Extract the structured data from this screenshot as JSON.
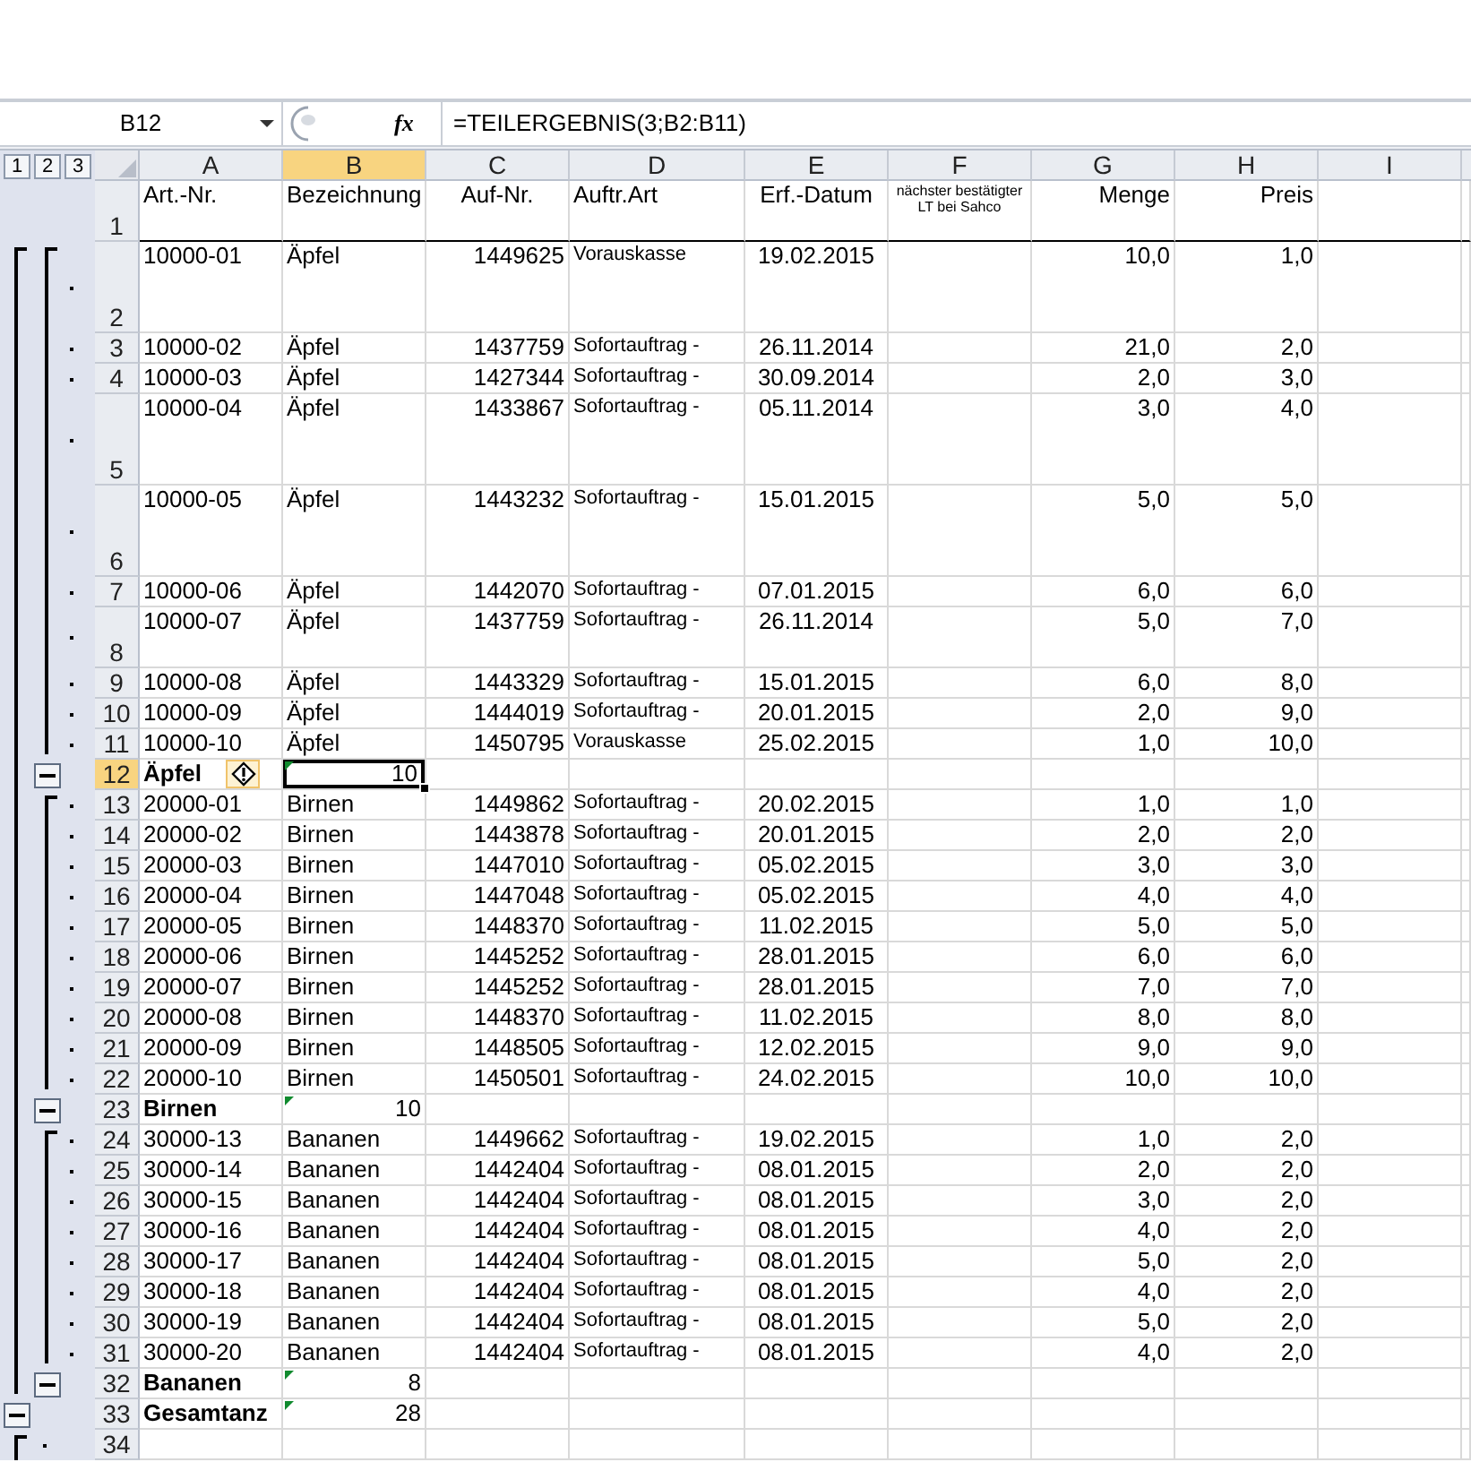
{
  "formula_bar": {
    "name_box": "B12",
    "function_label": "fx",
    "formula": "=TEILERGEBNIS(3;B2:B11)"
  },
  "outline_levels": [
    {
      "label": "1"
    },
    {
      "label": "2"
    },
    {
      "label": "3"
    }
  ],
  "columns": [
    {
      "label": "A",
      "selected": false
    },
    {
      "label": "B",
      "selected": true
    },
    {
      "label": "C",
      "selected": false
    },
    {
      "label": "D",
      "selected": false
    },
    {
      "label": "E",
      "selected": false
    },
    {
      "label": "F",
      "selected": false
    },
    {
      "label": "G",
      "selected": false
    },
    {
      "label": "H",
      "selected": false
    },
    {
      "label": "I",
      "selected": false
    }
  ],
  "rows": [
    {
      "number": "1",
      "kind": "header",
      "selected": false,
      "cells": [
        "Art.-Nr.",
        "Bezeichnung",
        "Auf-Nr.",
        "Auftr.Art",
        "Erf.-Datum",
        "nächster bestätigter LT bei Sahco",
        "Menge",
        "Preis"
      ]
    },
    {
      "number": "2",
      "kind": "detail",
      "selected": false,
      "cells": [
        "10000-01",
        "Äpfel",
        "1449625",
        "Vorauskasse",
        "19.02.2015",
        null,
        "10,0",
        "1,0"
      ]
    },
    {
      "number": "3",
      "kind": "detail",
      "selected": false,
      "cells": [
        "10000-02",
        "Äpfel",
        "1437759",
        "Sofortauftrag -",
        "26.11.2014",
        null,
        "21,0",
        "2,0"
      ]
    },
    {
      "number": "4",
      "kind": "detail",
      "selected": false,
      "cells": [
        "10000-03",
        "Äpfel",
        "1427344",
        "Sofortauftrag -",
        "30.09.2014",
        null,
        "2,0",
        "3,0"
      ]
    },
    {
      "number": "5",
      "kind": "detail",
      "selected": false,
      "cells": [
        "10000-04",
        "Äpfel",
        "1433867",
        "Sofortauftrag -",
        "05.11.2014",
        null,
        "3,0",
        "4,0"
      ]
    },
    {
      "number": "6",
      "kind": "detail",
      "selected": false,
      "cells": [
        "10000-05",
        "Äpfel",
        "1443232",
        "Sofortauftrag -",
        "15.01.2015",
        null,
        "5,0",
        "5,0"
      ]
    },
    {
      "number": "7",
      "kind": "detail",
      "selected": false,
      "cells": [
        "10000-06",
        "Äpfel",
        "1442070",
        "Sofortauftrag -",
        "07.01.2015",
        null,
        "6,0",
        "6,0"
      ]
    },
    {
      "number": "8",
      "kind": "detail",
      "selected": false,
      "cells": [
        "10000-07",
        "Äpfel",
        "1437759",
        "Sofortauftrag -",
        "26.11.2014",
        null,
        "5,0",
        "7,0"
      ]
    },
    {
      "number": "9",
      "kind": "detail",
      "selected": false,
      "cells": [
        "10000-08",
        "Äpfel",
        "1443329",
        "Sofortauftrag -",
        "15.01.2015",
        null,
        "6,0",
        "8,0"
      ]
    },
    {
      "number": "10",
      "kind": "detail",
      "selected": false,
      "cells": [
        "10000-09",
        "Äpfel",
        "1444019",
        "Sofortauftrag -",
        "20.01.2015",
        null,
        "2,0",
        "9,0"
      ]
    },
    {
      "number": "11",
      "kind": "detail",
      "selected": false,
      "cells": [
        "10000-10",
        "Äpfel",
        "1450795",
        "Vorauskasse",
        "25.02.2015",
        null,
        "1,0",
        "10,0"
      ]
    },
    {
      "number": "12",
      "kind": "subtotal",
      "selected": true,
      "error_marker": true,
      "smart_tag": true,
      "cells": [
        "Äpfel",
        "10"
      ]
    },
    {
      "number": "13",
      "kind": "detail",
      "selected": false,
      "cells": [
        "20000-01",
        "Birnen",
        "1449862",
        "Sofortauftrag -",
        "20.02.2015",
        null,
        "1,0",
        "1,0"
      ]
    },
    {
      "number": "14",
      "kind": "detail",
      "selected": false,
      "cells": [
        "20000-02",
        "Birnen",
        "1443878",
        "Sofortauftrag -",
        "20.01.2015",
        null,
        "2,0",
        "2,0"
      ]
    },
    {
      "number": "15",
      "kind": "detail",
      "selected": false,
      "cells": [
        "20000-03",
        "Birnen",
        "1447010",
        "Sofortauftrag -",
        "05.02.2015",
        null,
        "3,0",
        "3,0"
      ]
    },
    {
      "number": "16",
      "kind": "detail",
      "selected": false,
      "cells": [
        "20000-04",
        "Birnen",
        "1447048",
        "Sofortauftrag -",
        "05.02.2015",
        null,
        "4,0",
        "4,0"
      ]
    },
    {
      "number": "17",
      "kind": "detail",
      "selected": false,
      "cells": [
        "20000-05",
        "Birnen",
        "1448370",
        "Sofortauftrag -",
        "11.02.2015",
        null,
        "5,0",
        "5,0"
      ]
    },
    {
      "number": "18",
      "kind": "detail",
      "selected": false,
      "cells": [
        "20000-06",
        "Birnen",
        "1445252",
        "Sofortauftrag -",
        "28.01.2015",
        null,
        "6,0",
        "6,0"
      ]
    },
    {
      "number": "19",
      "kind": "detail",
      "selected": false,
      "cells": [
        "20000-07",
        "Birnen",
        "1445252",
        "Sofortauftrag -",
        "28.01.2015",
        null,
        "7,0",
        "7,0"
      ]
    },
    {
      "number": "20",
      "kind": "detail",
      "selected": false,
      "cells": [
        "20000-08",
        "Birnen",
        "1448370",
        "Sofortauftrag -",
        "11.02.2015",
        null,
        "8,0",
        "8,0"
      ]
    },
    {
      "number": "21",
      "kind": "detail",
      "selected": false,
      "cells": [
        "20000-09",
        "Birnen",
        "1448505",
        "Sofortauftrag -",
        "12.02.2015",
        null,
        "9,0",
        "9,0"
      ]
    },
    {
      "number": "22",
      "kind": "detail",
      "selected": false,
      "cells": [
        "20000-10",
        "Birnen",
        "1450501",
        "Sofortauftrag -",
        "24.02.2015",
        null,
        "10,0",
        "10,0"
      ]
    },
    {
      "number": "23",
      "kind": "subtotal",
      "selected": false,
      "error_marker": true,
      "cells": [
        "Birnen",
        "10"
      ]
    },
    {
      "number": "24",
      "kind": "detail",
      "selected": false,
      "cells": [
        "30000-13",
        "Bananen",
        "1449662",
        "Sofortauftrag -",
        "19.02.2015",
        null,
        "1,0",
        "2,0"
      ]
    },
    {
      "number": "25",
      "kind": "detail",
      "selected": false,
      "cells": [
        "30000-14",
        "Bananen",
        "1442404",
        "Sofortauftrag -",
        "08.01.2015",
        null,
        "2,0",
        "2,0"
      ]
    },
    {
      "number": "26",
      "kind": "detail",
      "selected": false,
      "cells": [
        "30000-15",
        "Bananen",
        "1442404",
        "Sofortauftrag -",
        "08.01.2015",
        null,
        "3,0",
        "2,0"
      ]
    },
    {
      "number": "27",
      "kind": "detail",
      "selected": false,
      "cells": [
        "30000-16",
        "Bananen",
        "1442404",
        "Sofortauftrag -",
        "08.01.2015",
        null,
        "4,0",
        "2,0"
      ]
    },
    {
      "number": "28",
      "kind": "detail",
      "selected": false,
      "cells": [
        "30000-17",
        "Bananen",
        "1442404",
        "Sofortauftrag -",
        "08.01.2015",
        null,
        "5,0",
        "2,0"
      ]
    },
    {
      "number": "29",
      "kind": "detail",
      "selected": false,
      "cells": [
        "30000-18",
        "Bananen",
        "1442404",
        "Sofortauftrag -",
        "08.01.2015",
        null,
        "4,0",
        "2,0"
      ]
    },
    {
      "number": "30",
      "kind": "detail",
      "selected": false,
      "cells": [
        "30000-19",
        "Bananen",
        "1442404",
        "Sofortauftrag -",
        "08.01.2015",
        null,
        "5,0",
        "2,0"
      ]
    },
    {
      "number": "31",
      "kind": "detail",
      "selected": false,
      "cells": [
        "30000-20",
        "Bananen",
        "1442404",
        "Sofortauftrag -",
        "08.01.2015",
        null,
        "4,0",
        "2,0"
      ]
    },
    {
      "number": "32",
      "kind": "subtotal",
      "selected": false,
      "error_marker": true,
      "cells": [
        "Bananen",
        "8"
      ]
    },
    {
      "number": "33",
      "kind": "total",
      "selected": false,
      "error_marker": true,
      "cells": [
        "Gesamtanz",
        "28"
      ]
    },
    {
      "number": "34",
      "kind": "detail-outer",
      "selected": false
    }
  ]
}
